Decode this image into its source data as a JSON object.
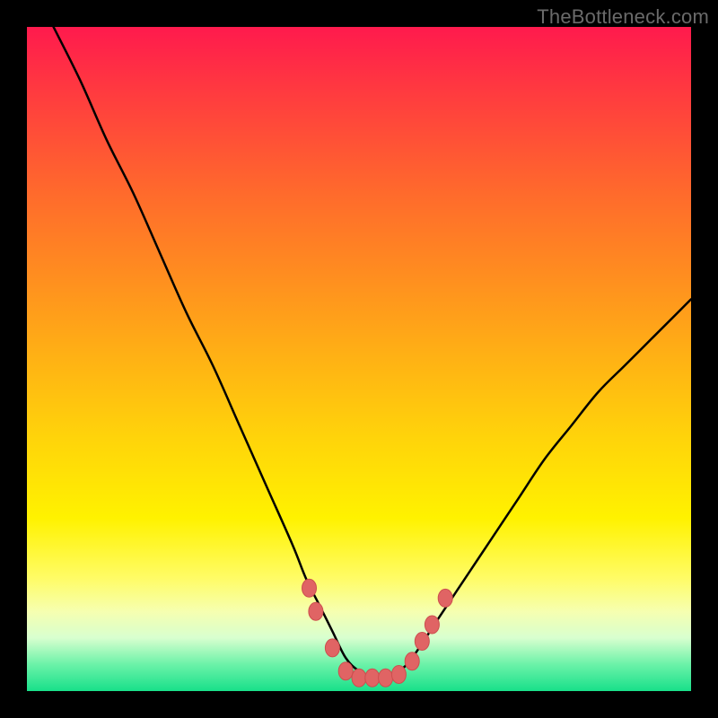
{
  "watermark": "TheBottleneck.com",
  "colors": {
    "curve_stroke": "#000000",
    "marker_fill": "#e06464",
    "marker_stroke": "#cc4e4e"
  },
  "chart_data": {
    "type": "line",
    "title": "",
    "xlabel": "",
    "ylabel": "",
    "xlim": [
      0,
      100
    ],
    "ylim": [
      0,
      100
    ],
    "series": [
      {
        "name": "curve",
        "x": [
          4,
          8,
          12,
          16,
          20,
          24,
          28,
          32,
          36,
          40,
          42,
          44,
          46,
          48,
          50,
          52,
          54,
          56,
          58,
          62,
          66,
          70,
          74,
          78,
          82,
          86,
          90,
          94,
          98,
          100
        ],
        "y": [
          100,
          92,
          83,
          75,
          66,
          57,
          49,
          40,
          31,
          22,
          17,
          13,
          9,
          5,
          3,
          2,
          2,
          3,
          5,
          11,
          17,
          23,
          29,
          35,
          40,
          45,
          49,
          53,
          57,
          59
        ]
      }
    ],
    "markers": [
      {
        "x": 42.5,
        "y": 15.5
      },
      {
        "x": 43.5,
        "y": 12.0
      },
      {
        "x": 46.0,
        "y": 6.5
      },
      {
        "x": 48.0,
        "y": 3.0
      },
      {
        "x": 50.0,
        "y": 2.0
      },
      {
        "x": 52.0,
        "y": 2.0
      },
      {
        "x": 54.0,
        "y": 2.0
      },
      {
        "x": 56.0,
        "y": 2.5
      },
      {
        "x": 58.0,
        "y": 4.5
      },
      {
        "x": 59.5,
        "y": 7.5
      },
      {
        "x": 61.0,
        "y": 10.0
      },
      {
        "x": 63.0,
        "y": 14.0
      }
    ]
  }
}
